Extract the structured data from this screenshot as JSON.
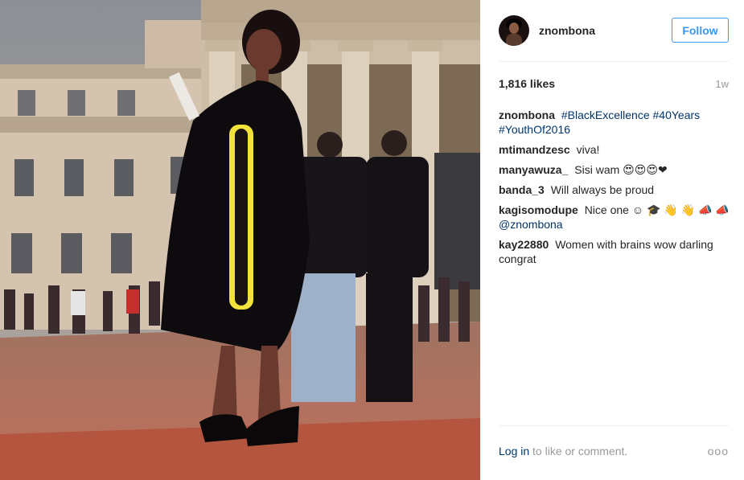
{
  "post": {
    "username": "znombona",
    "follow_label": "Follow",
    "likes": "1,816 likes",
    "time": "1w",
    "caption_user": "znombona",
    "caption_tags": [
      "#BlackExcellence",
      "#40Years",
      "#YouthOf2016"
    ],
    "comments": [
      {
        "user": "mtimandzesc",
        "text": "viva!"
      },
      {
        "user": "manyawuza_",
        "text": "Sisi wam 😍😍😍❤"
      },
      {
        "user": "banda_3",
        "text": "Will always be proud"
      },
      {
        "user": "kagisomodupe",
        "text": "Nice one ☺ 🎓 👋 👋 📣 📣",
        "mention": "@znombona"
      },
      {
        "user": "kay22880",
        "text": "Women with brains wow darling congrat"
      }
    ],
    "login_link": "Log in",
    "login_suffix": " to like or comment.",
    "more_label": "ooo"
  }
}
